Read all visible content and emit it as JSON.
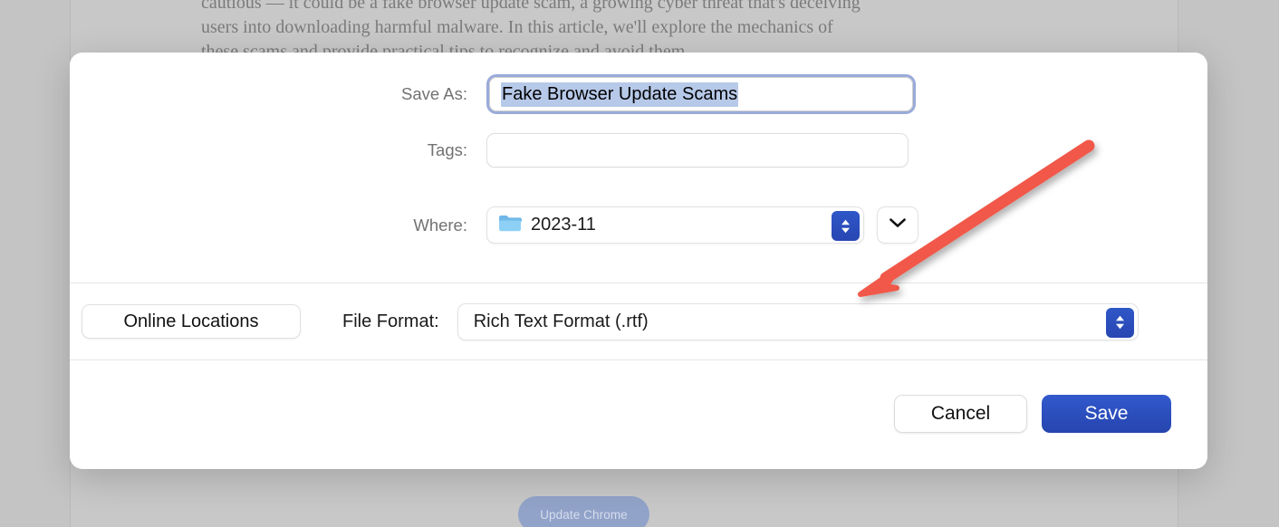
{
  "background_document": {
    "paragraph_lines": [
      "cautious — it could be a fake browser update scam, a growing cyber threat that's deceiving",
      "users into downloading harmful malware. In this article, we'll explore the mechanics of",
      "these scams and provide practical tips to recognize and avoid them."
    ],
    "update_button_label": "Update Chrome"
  },
  "dialog": {
    "fields": {
      "save_as": {
        "label": "Save As:",
        "value": "Fake Browser Update Scams",
        "placeholder": "",
        "selected_text": "Fake Browser Update Scams",
        "focused": "true"
      },
      "tags": {
        "label": "Tags:",
        "value": "",
        "placeholder": ""
      },
      "where": {
        "label": "Where:",
        "value": "2023-11",
        "folder_icon": "folder-icon",
        "stepper_icon": "up-down-chevron-icon",
        "expand_icon": "chevron-down-icon"
      }
    },
    "middle": {
      "online_locations_label": "Online Locations",
      "file_format_label": "File Format:",
      "file_format_value": "Rich Text Format (.rtf)",
      "file_format_stepper_icon": "up-down-chevron-icon"
    },
    "footer": {
      "cancel_label": "Cancel",
      "save_label": "Save"
    }
  },
  "annotation": {
    "arrow_color": "#f15a4a",
    "arrow_name": "red-pointer-arrow"
  },
  "colors": {
    "accent_blue": "#2b4fc0",
    "focus_ring": "#9aabda",
    "selection": "#b7c9e9",
    "page_background": "#c4c4c4",
    "dialog_background": "#ffffff"
  }
}
